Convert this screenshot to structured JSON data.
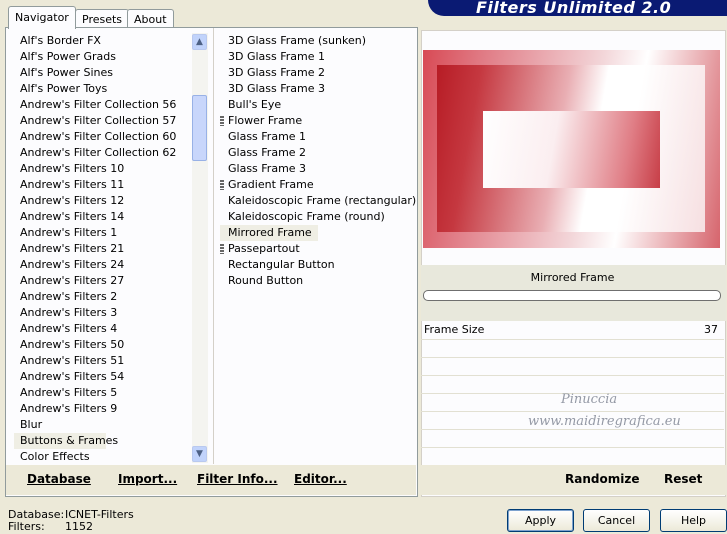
{
  "banner": {
    "title": "Filters Unlimited 2.0"
  },
  "tabs": [
    {
      "label": "Navigator",
      "active": true
    },
    {
      "label": "Presets",
      "active": false
    },
    {
      "label": "About",
      "active": false
    }
  ],
  "categories": [
    "Alf's Border FX",
    "Alf's Power Grads",
    "Alf's Power Sines",
    "Alf's Power Toys",
    "Andrew's Filter Collection 56",
    "Andrew's Filter Collection 57",
    "Andrew's Filter Collection 60",
    "Andrew's Filter Collection 62",
    "Andrew's Filters 10",
    "Andrew's Filters 11",
    "Andrew's Filters 12",
    "Andrew's Filters 14",
    "Andrew's Filters 1",
    "Andrew's Filters 21",
    "Andrew's Filters 24",
    "Andrew's Filters 27",
    "Andrew's Filters 2",
    "Andrew's Filters 3",
    "Andrew's Filters 4",
    "Andrew's Filters 50",
    "Andrew's Filters 51",
    "Andrew's Filters 54",
    "Andrew's Filters 5",
    "Andrew's Filters 9",
    "Blur",
    "Buttons & Frames",
    "Color Effects"
  ],
  "selected_category": "Buttons & Frames",
  "filters": [
    {
      "label": "3D Glass Frame (sunken)",
      "marker": false
    },
    {
      "label": "3D Glass Frame 1",
      "marker": false
    },
    {
      "label": "3D Glass Frame 2",
      "marker": false
    },
    {
      "label": "3D Glass Frame 3",
      "marker": false
    },
    {
      "label": "Bull's Eye",
      "marker": false
    },
    {
      "label": "Flower Frame",
      "marker": true
    },
    {
      "label": "Glass Frame 1",
      "marker": false
    },
    {
      "label": "Glass Frame 2",
      "marker": false
    },
    {
      "label": "Glass Frame 3",
      "marker": false
    },
    {
      "label": "Gradient Frame",
      "marker": true
    },
    {
      "label": "Kaleidoscopic Frame (rectangular)",
      "marker": false
    },
    {
      "label": "Kaleidoscopic Frame (round)",
      "marker": false
    },
    {
      "label": "Mirrored Frame",
      "marker": false
    },
    {
      "label": "Passepartout",
      "marker": true
    },
    {
      "label": "Rectangular Button",
      "marker": false
    },
    {
      "label": "Round Button",
      "marker": false
    }
  ],
  "selected_filter": "Mirrored Frame",
  "left_buttons": {
    "database": "Database",
    "import": "Import...",
    "filter_info": "Filter Info...",
    "editor": "Editor..."
  },
  "preview": {
    "filter_name": "Mirrored Frame",
    "colors": {
      "dark_red": "#b71c25",
      "light": "#ffffff"
    }
  },
  "params": [
    {
      "label": "Frame Size",
      "value": "37"
    }
  ],
  "watermark": {
    "line1": "Pinuccia",
    "line2": "www.maidiregrafica.eu"
  },
  "right_buttons": {
    "randomize": "Randomize",
    "reset": "Reset"
  },
  "footer": {
    "database_label": "Database:",
    "database_value": "ICNET-Filters",
    "filters_label": "Filters:",
    "filters_value": "1152"
  },
  "dialog_buttons": {
    "apply": "Apply",
    "cancel": "Cancel",
    "help": "Help"
  },
  "icons": {
    "scroll_up": "chevron-up-icon",
    "scroll_down": "chevron-down-icon"
  }
}
